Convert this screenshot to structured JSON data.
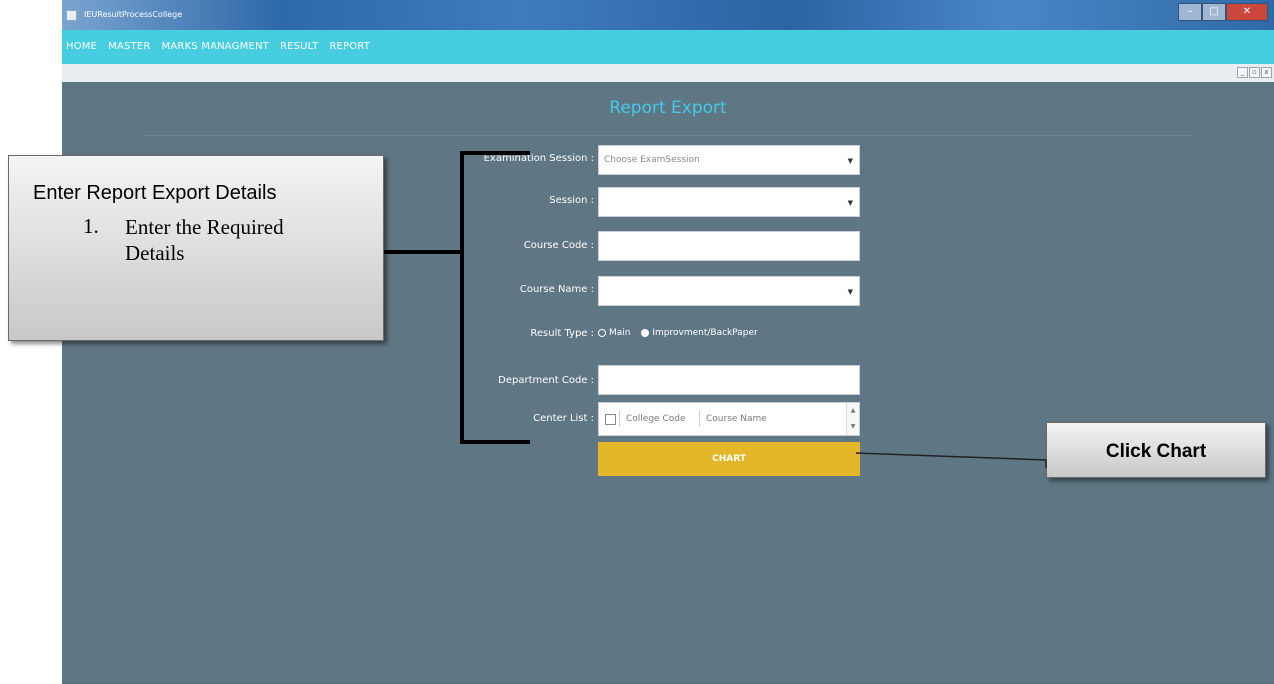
{
  "window": {
    "title": "IEUResultProcessCollege",
    "min": "–",
    "max": "□",
    "close": "✕"
  },
  "menu": [
    "HOME",
    "MASTER",
    "MARKS MANAGMENT",
    "RESULT",
    "REPORT"
  ],
  "mdi": {
    "min": "_",
    "restore": "▫",
    "close": "x"
  },
  "page": {
    "title": "Report Export"
  },
  "form": {
    "exam_session_label": "Examination Session :",
    "exam_session_placeholder": "Choose ExamSession",
    "session_label": "Session :",
    "course_code_label": "Course Code :",
    "course_name_label": "Course Name :",
    "result_type_label": "Result Type :",
    "result_options": [
      "Main",
      "Improvment/BackPaper"
    ],
    "result_selected": "Improvment/BackPaper",
    "department_code_label": "Department Code :",
    "center_list_label": "Center List :",
    "center_columns": [
      "College Code",
      "Course Name"
    ],
    "dropdown_arrow": "▼",
    "scroll_up": "▲",
    "scroll_down": "▼",
    "chart_button": "CHART"
  },
  "callouts": {
    "details_title": "Enter Report Export Details",
    "details_number": "1.",
    "details_text": "Enter the Required Details",
    "click_chart": "Click Chart"
  },
  "colors": {
    "menubar": "#47cde0",
    "background": "#5f7684",
    "title": "#45c9e8",
    "chart_button": "#e4b62a"
  }
}
